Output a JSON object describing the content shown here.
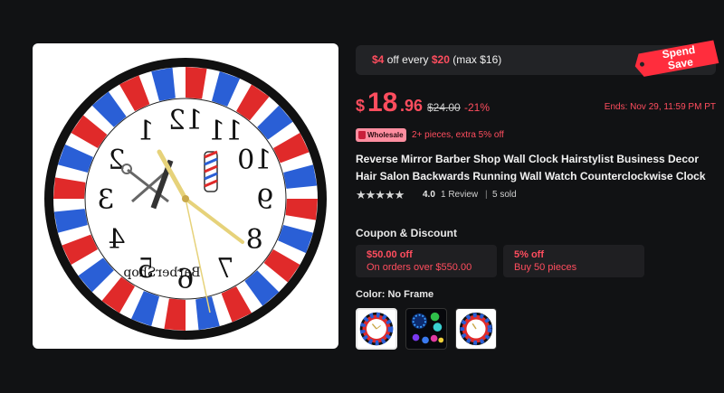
{
  "promo": {
    "amount": "$4",
    "text1": "off every",
    "threshold": "$20",
    "text2": "(max $16)",
    "tag_line1": "Spend",
    "tag_line2": "Save"
  },
  "price": {
    "currency": "$",
    "integer": "18",
    "decimal": ".96",
    "original": "$24.00",
    "discount": "-21%",
    "ends": "Ends: Nov 29, 11:59 PM PT"
  },
  "wholesale": {
    "badge": "Wholesale",
    "text": "2+ pieces, extra 5% off"
  },
  "product": {
    "title": "Reverse Mirror Barber Shop Wall Clock Hairstylist Business Decor Hair Salon Backwards Running Wall Watch Counterclockwise Clock",
    "clock_text": "BarberShop"
  },
  "rating": {
    "stars": "★★★★★",
    "value": "4.0",
    "reviews": "1 Review",
    "separator": "|",
    "sold": "5 sold"
  },
  "coupons": {
    "heading": "Coupon & Discount",
    "items": [
      {
        "title": "$50.00 off",
        "subtitle": "On orders over $550.00"
      },
      {
        "title": "5% off",
        "subtitle": "Buy 50 pieces"
      }
    ]
  },
  "color": {
    "label": "Color: No Frame",
    "selected": 0
  },
  "colors": {
    "accent": "#ff4d5e",
    "background": "#111214",
    "panel": "#222326",
    "clock_red": "#e02a2a",
    "clock_blue": "#2a5fd6"
  },
  "icons": [
    "bag-icon",
    "star-icon",
    "price-tag-icon"
  ]
}
